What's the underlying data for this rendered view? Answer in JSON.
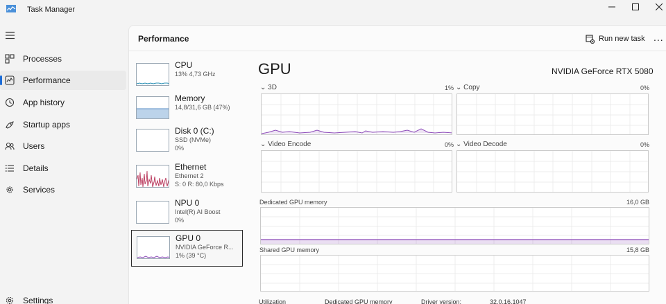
{
  "window": {
    "title": "Task Manager"
  },
  "nav": {
    "items": [
      {
        "label": "Processes",
        "icon": "processes-icon"
      },
      {
        "label": "Performance",
        "icon": "performance-icon",
        "active": true
      },
      {
        "label": "App history",
        "icon": "app-history-icon"
      },
      {
        "label": "Startup apps",
        "icon": "startup-apps-icon"
      },
      {
        "label": "Users",
        "icon": "users-icon"
      },
      {
        "label": "Details",
        "icon": "details-icon"
      },
      {
        "label": "Services",
        "icon": "services-icon"
      }
    ],
    "settings_label": "Settings"
  },
  "header": {
    "title": "Performance",
    "run_new_task": "Run new task",
    "more": "..."
  },
  "devices": [
    {
      "name": "CPU",
      "line1": "13% 4,73 GHz",
      "line2": ""
    },
    {
      "name": "Memory",
      "line1": "14,8/31,6 GB (47%)",
      "line2": ""
    },
    {
      "name": "Disk 0 (C:)",
      "line1": "SSD (NVMe)",
      "line2": "0%"
    },
    {
      "name": "Ethernet",
      "line1": "Ethernet 2",
      "line2": "S: 0 R: 80,0 Kbps"
    },
    {
      "name": "NPU 0",
      "line1": "Intel(R) AI Boost",
      "line2": "0%"
    },
    {
      "name": "GPU 0",
      "line1": "NVIDIA GeForce R...",
      "line2": "1% (39 °C)"
    }
  ],
  "gpu": {
    "title": "GPU",
    "model": "NVIDIA GeForce RTX 5080",
    "engines": [
      {
        "label": "3D",
        "percent": "1%"
      },
      {
        "label": "Copy",
        "percent": "0%"
      },
      {
        "label": "Video Encode",
        "percent": "0%"
      },
      {
        "label": "Video Decode",
        "percent": "0%"
      }
    ],
    "dedicated_memory": {
      "label": "Dedicated GPU memory",
      "capacity": "16,0 GB"
    },
    "shared_memory": {
      "label": "Shared GPU memory",
      "capacity": "15,8 GB"
    },
    "stats": {
      "utilization_label": "Utilization",
      "dedicated_label": "Dedicated GPU memory",
      "driver_label": "Driver version:",
      "driver_value": "32.0.16.1047"
    }
  },
  "colors": {
    "gpu_line": "#8b49b8",
    "cpu_line": "#2a8fb4",
    "memory_fill": "#bcd3ea",
    "ethernet_line": "#b8365a",
    "accent": "#1a6bd6"
  }
}
